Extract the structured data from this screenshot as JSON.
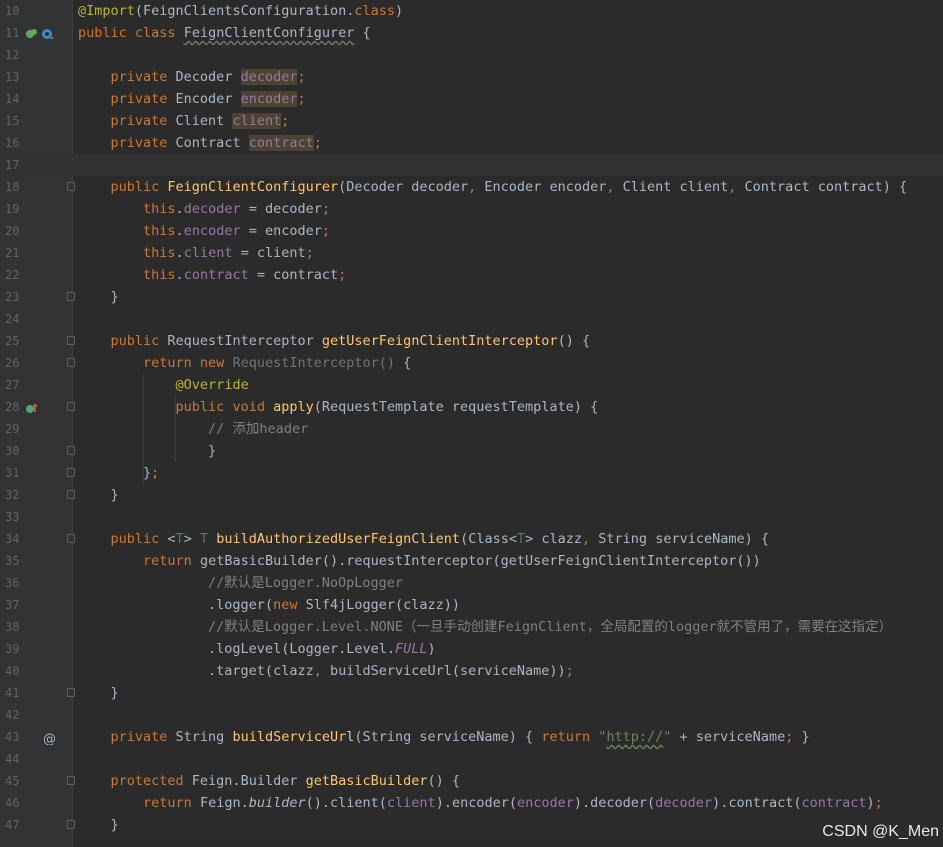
{
  "editor": {
    "lines": [
      {
        "n": "10",
        "t": [
          [
            "a",
            "@Import"
          ],
          [
            "p",
            "(FeignClientsConfiguration."
          ],
          [
            "k",
            "class"
          ],
          [
            "p",
            ")"
          ]
        ]
      },
      {
        "n": "11",
        "t": [
          [
            "k",
            "public "
          ],
          [
            "k",
            "class "
          ],
          [
            "wg",
            "FeignClientConfigurer"
          ],
          [
            "p",
            " {"
          ]
        ],
        "gicons": [
          "bean-icon",
          "override-nav-icon"
        ]
      },
      {
        "n": "12",
        "t": []
      },
      {
        "n": "13",
        "t": [
          [
            "p",
            "    "
          ],
          [
            "k",
            "private "
          ],
          [
            "p",
            "Decoder "
          ],
          [
            "fh",
            "decoder"
          ],
          [
            "k",
            ";"
          ]
        ]
      },
      {
        "n": "14",
        "t": [
          [
            "p",
            "    "
          ],
          [
            "k",
            "private "
          ],
          [
            "p",
            "Encoder "
          ],
          [
            "fh",
            "encoder"
          ],
          [
            "k",
            ";"
          ]
        ]
      },
      {
        "n": "15",
        "t": [
          [
            "p",
            "    "
          ],
          [
            "k",
            "private "
          ],
          [
            "p",
            "Client "
          ],
          [
            "fh",
            "client"
          ],
          [
            "k",
            ";"
          ]
        ]
      },
      {
        "n": "16",
        "t": [
          [
            "p",
            "    "
          ],
          [
            "k",
            "private "
          ],
          [
            "p",
            "Contract "
          ],
          [
            "fh",
            "contract"
          ],
          [
            "k",
            ";"
          ]
        ]
      },
      {
        "n": "17",
        "t": [],
        "current": true
      },
      {
        "n": "18",
        "t": [
          [
            "p",
            "    "
          ],
          [
            "k",
            "public "
          ],
          [
            "fn",
            "FeignClientConfigurer"
          ],
          [
            "p",
            "(Decoder decoder"
          ],
          [
            "k",
            ", "
          ],
          [
            "p",
            "Encoder encoder"
          ],
          [
            "k",
            ", "
          ],
          [
            "p",
            "Client client"
          ],
          [
            "k",
            ", "
          ],
          [
            "p",
            "Contract contract) {"
          ]
        ],
        "fold": true
      },
      {
        "n": "19",
        "t": [
          [
            "p",
            "        "
          ],
          [
            "k",
            "this"
          ],
          [
            "p",
            "."
          ],
          [
            "f",
            "decoder"
          ],
          [
            "p",
            " = decoder"
          ],
          [
            "k",
            ";"
          ]
        ]
      },
      {
        "n": "20",
        "t": [
          [
            "p",
            "        "
          ],
          [
            "k",
            "this"
          ],
          [
            "p",
            "."
          ],
          [
            "f",
            "encoder"
          ],
          [
            "p",
            " = encoder"
          ],
          [
            "k",
            ";"
          ]
        ]
      },
      {
        "n": "21",
        "t": [
          [
            "p",
            "        "
          ],
          [
            "k",
            "this"
          ],
          [
            "p",
            "."
          ],
          [
            "f",
            "client"
          ],
          [
            "p",
            " = client"
          ],
          [
            "k",
            ";"
          ]
        ]
      },
      {
        "n": "22",
        "t": [
          [
            "p",
            "        "
          ],
          [
            "k",
            "this"
          ],
          [
            "p",
            "."
          ],
          [
            "f",
            "contract"
          ],
          [
            "p",
            " = contract"
          ],
          [
            "k",
            ";"
          ]
        ]
      },
      {
        "n": "23",
        "t": [
          [
            "p",
            "    }"
          ]
        ],
        "fold": true
      },
      {
        "n": "24",
        "t": []
      },
      {
        "n": "25",
        "t": [
          [
            "p",
            "    "
          ],
          [
            "k",
            "public "
          ],
          [
            "p",
            "RequestInterceptor "
          ],
          [
            "fn",
            "getUserFeignClientInterceptor"
          ],
          [
            "p",
            "() {"
          ]
        ],
        "fold": true
      },
      {
        "n": "26",
        "t": [
          [
            "p",
            "        "
          ],
          [
            "k",
            "return new "
          ],
          [
            "d",
            "RequestInterceptor() "
          ],
          [
            "p",
            "{"
          ]
        ],
        "fold": true
      },
      {
        "n": "27",
        "t": [
          [
            "p",
            "            "
          ],
          [
            "a",
            "@Override"
          ]
        ]
      },
      {
        "n": "28",
        "t": [
          [
            "p",
            "            "
          ],
          [
            "k",
            "public void "
          ],
          [
            "fn",
            "apply"
          ],
          [
            "p",
            "(RequestTemplate requestTemplate) {"
          ]
        ],
        "fold": true,
        "gicons": [
          "implements-icon"
        ]
      },
      {
        "n": "29",
        "t": [
          [
            "p",
            "                "
          ],
          [
            "c",
            "// 添加header"
          ]
        ]
      },
      {
        "n": "30",
        "t": [
          [
            "p",
            "                }"
          ]
        ],
        "fold": true
      },
      {
        "n": "31",
        "t": [
          [
            "p",
            "        }"
          ],
          [
            "k",
            ";"
          ]
        ],
        "fold": true
      },
      {
        "n": "32",
        "t": [
          [
            "p",
            "    }"
          ]
        ],
        "fold": true
      },
      {
        "n": "33",
        "t": []
      },
      {
        "n": "34",
        "t": [
          [
            "p",
            "    "
          ],
          [
            "k",
            "public "
          ],
          [
            "p",
            "<"
          ],
          [
            "tp",
            "T"
          ],
          [
            "p",
            "> "
          ],
          [
            "tp",
            "T "
          ],
          [
            "fn",
            "buildAuthorizedUserFeignClient"
          ],
          [
            "p",
            "(Class<"
          ],
          [
            "tp",
            "T"
          ],
          [
            "p",
            "> clazz"
          ],
          [
            "k",
            ", "
          ],
          [
            "p",
            "String serviceName) {"
          ]
        ],
        "fold": true
      },
      {
        "n": "35",
        "t": [
          [
            "p",
            "        "
          ],
          [
            "k",
            "return "
          ],
          [
            "p",
            "getBasicBuilder().requestInterceptor(getUserFeignClientInterceptor())"
          ]
        ]
      },
      {
        "n": "36",
        "t": [
          [
            "p",
            "                "
          ],
          [
            "c",
            "//默认是Logger.NoOpLogger"
          ]
        ]
      },
      {
        "n": "37",
        "t": [
          [
            "p",
            "                .logger("
          ],
          [
            "k",
            "new "
          ],
          [
            "p",
            "Slf4jLogger(clazz))"
          ]
        ]
      },
      {
        "n": "38",
        "t": [
          [
            "p",
            "                "
          ],
          [
            "c",
            "//默认是Logger.Level.NONE（一旦手动创建FeignClient，全局配置的logger就不管用了，需要在这指定）"
          ]
        ]
      },
      {
        "n": "39",
        "t": [
          [
            "p",
            "                .logLevel(Logger.Level."
          ],
          [
            "fi",
            "FULL"
          ],
          [
            "p",
            ")"
          ]
        ]
      },
      {
        "n": "40",
        "t": [
          [
            "p",
            "                .target(clazz"
          ],
          [
            "k",
            ", "
          ],
          [
            "p",
            "buildServiceUrl(serviceName))"
          ],
          [
            "k",
            ";"
          ]
        ]
      },
      {
        "n": "41",
        "t": [
          [
            "p",
            "    }"
          ]
        ],
        "fold": true
      },
      {
        "n": "42",
        "t": []
      },
      {
        "n": "43",
        "t": [
          [
            "p",
            "    "
          ],
          [
            "k",
            "private "
          ],
          [
            "p",
            "String "
          ],
          [
            "fn",
            "buildServiceUrl"
          ],
          [
            "p",
            "(String serviceName) { "
          ],
          [
            "k",
            "return "
          ],
          [
            "s",
            "\""
          ],
          [
            "ws",
            "http://"
          ],
          [
            "s",
            "\""
          ],
          [
            "p",
            " + serviceName"
          ],
          [
            "k",
            "; "
          ],
          [
            "p",
            "}"
          ]
        ],
        "gicons": [
          "at-icon"
        ]
      },
      {
        "n": "44",
        "t": []
      },
      {
        "n": "45",
        "t": [
          [
            "p",
            "    "
          ],
          [
            "k",
            "protected "
          ],
          [
            "p",
            "Feign.Builder "
          ],
          [
            "fn",
            "getBasicBuilder"
          ],
          [
            "p",
            "() {"
          ]
        ],
        "fold": true
      },
      {
        "n": "46",
        "t": [
          [
            "p",
            "        "
          ],
          [
            "k",
            "return "
          ],
          [
            "p",
            "Feign."
          ],
          [
            "i",
            "builder"
          ],
          [
            "p",
            "().client("
          ],
          [
            "f",
            "client"
          ],
          [
            "p",
            ").encoder("
          ],
          [
            "f",
            "encoder"
          ],
          [
            "p",
            ").decoder("
          ],
          [
            "f",
            "decoder"
          ],
          [
            "p",
            ").contract("
          ],
          [
            "f",
            "contract"
          ],
          [
            "p",
            ")"
          ],
          [
            "k",
            ";"
          ]
        ]
      },
      {
        "n": "47",
        "t": [
          [
            "p",
            "    }"
          ]
        ],
        "fold": true
      }
    ]
  },
  "watermark": "CSDN @K_Men",
  "colors": {
    "background": "#2b2b2b",
    "keyword": "#cc7832",
    "annotation": "#bbb529",
    "field": "#9876aa",
    "method": "#ffc66d",
    "comment": "#808080",
    "string": "#6a8759"
  }
}
